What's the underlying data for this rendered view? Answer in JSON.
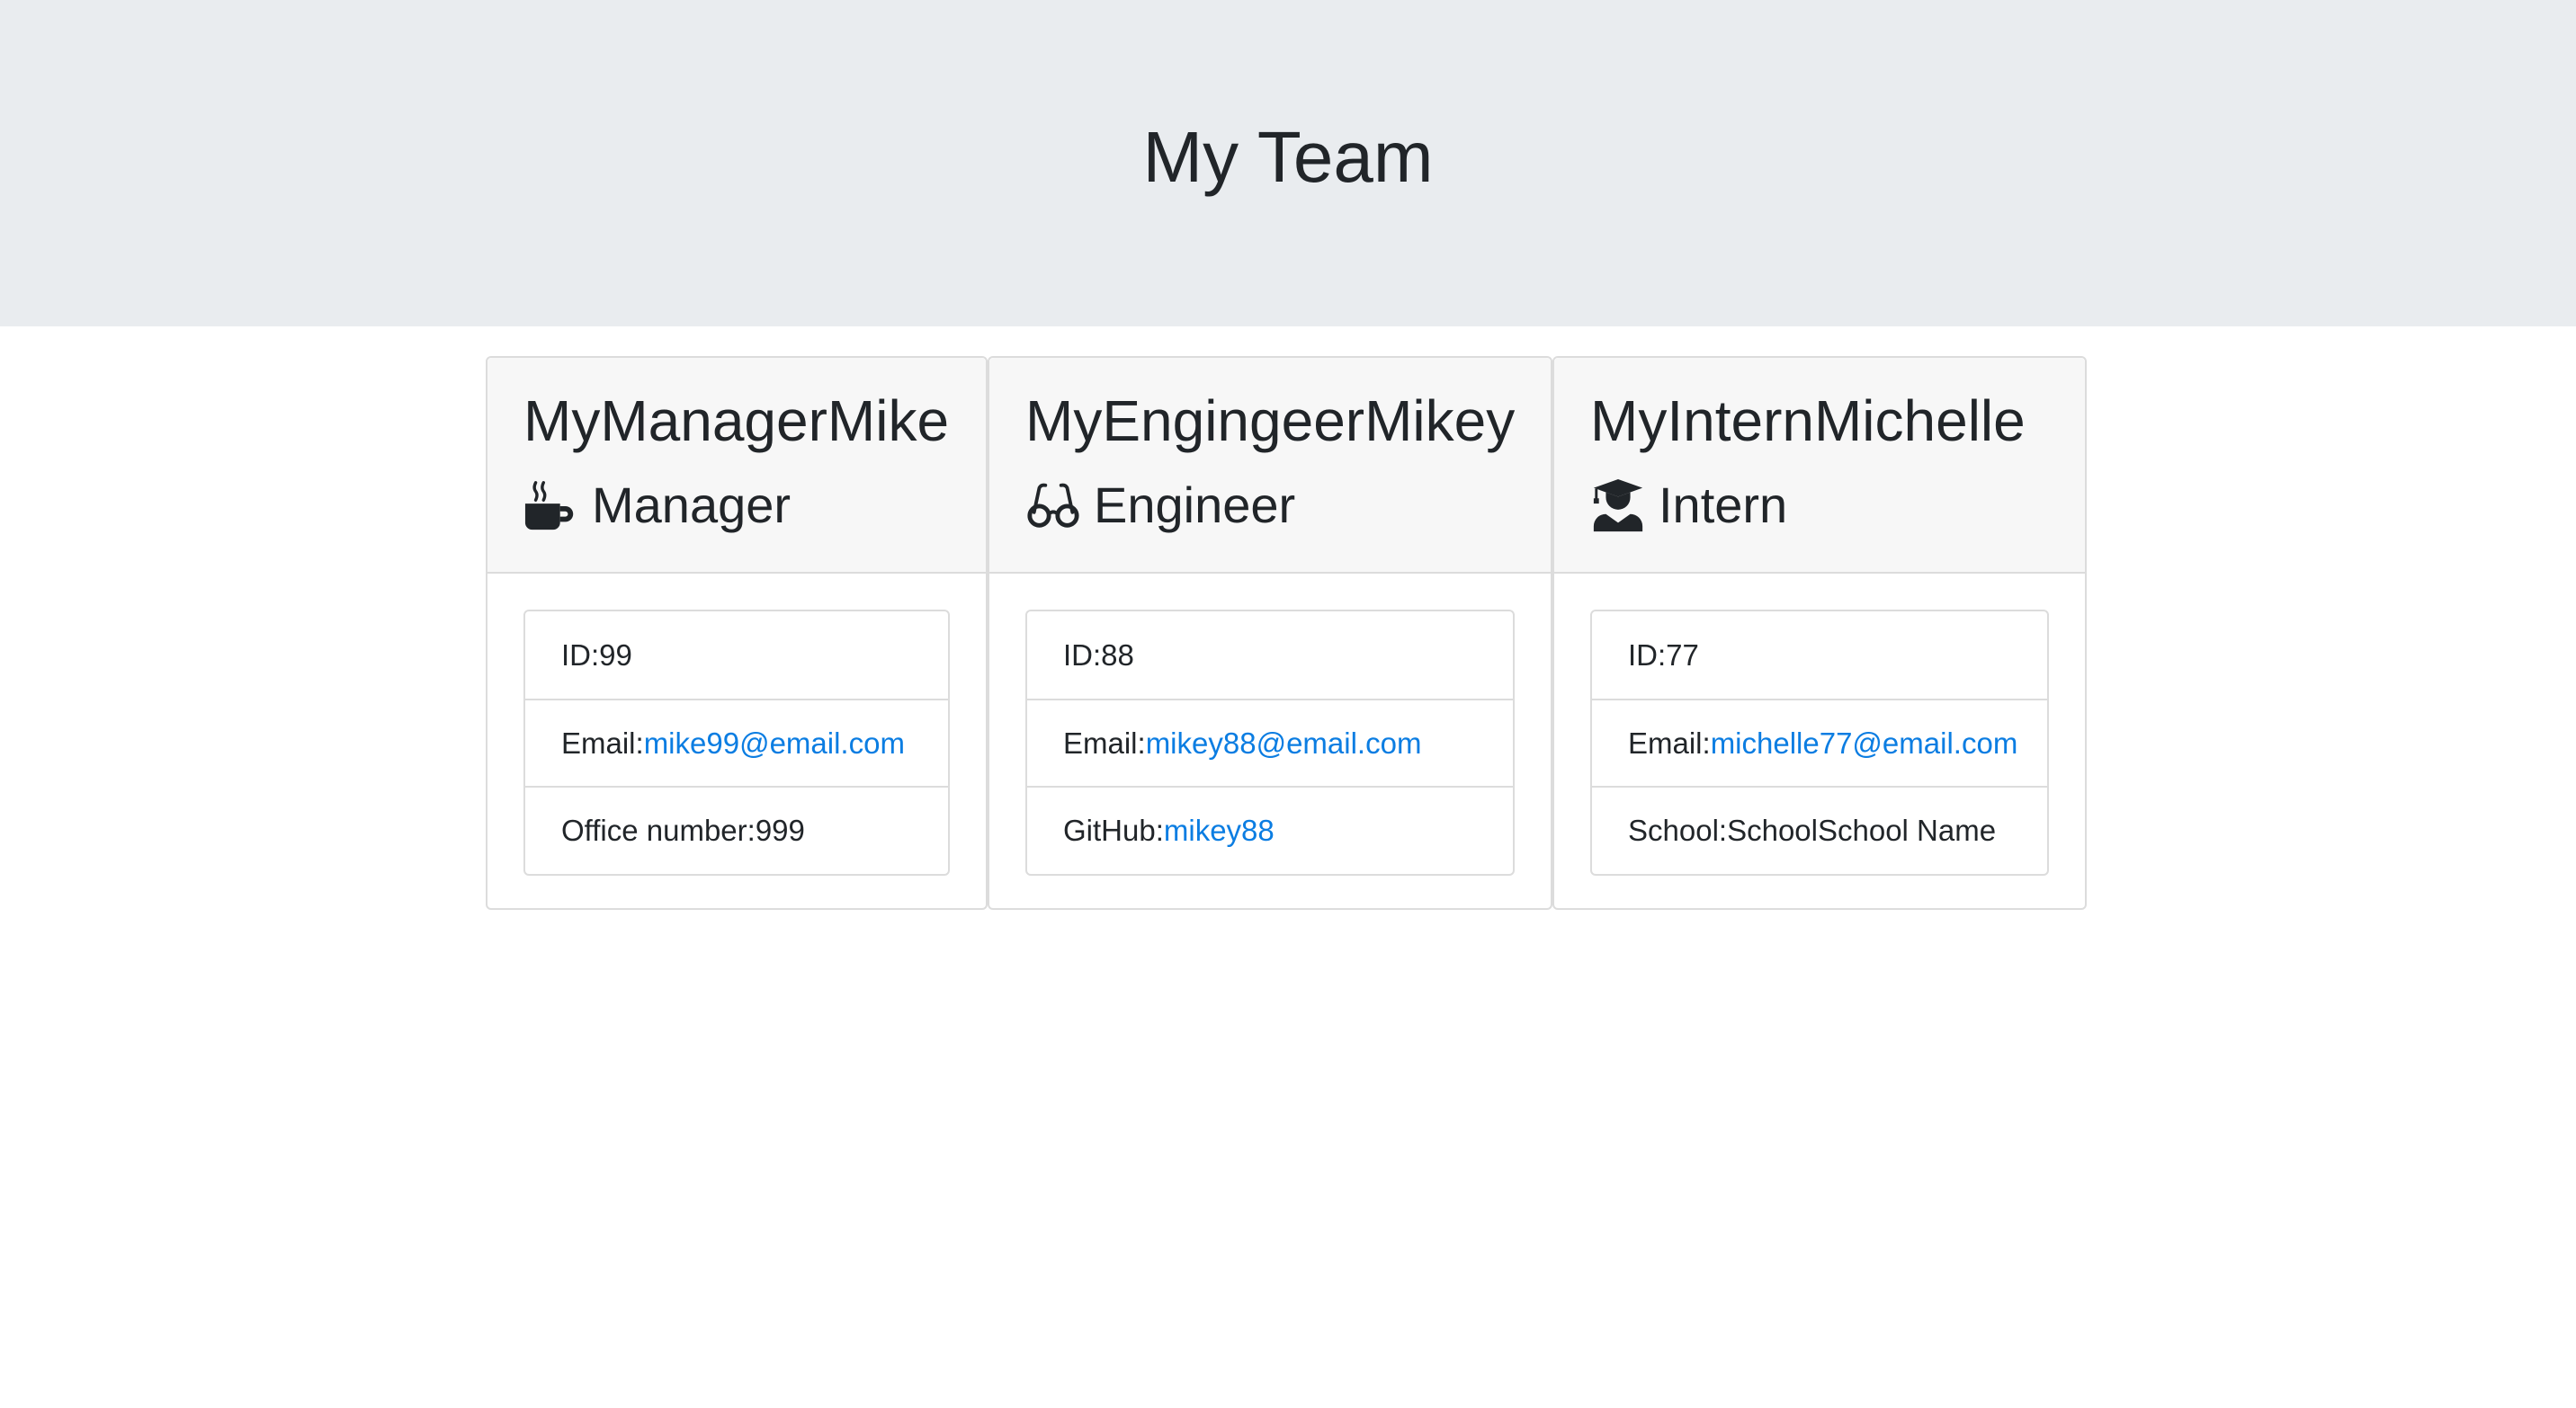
{
  "header": {
    "title": "My Team"
  },
  "cards": [
    {
      "name": "MyManagerMike",
      "role": "Manager",
      "icon": "coffee-mug-icon",
      "id_label": "ID: ",
      "id_value": "99",
      "email_label": "Email: ",
      "email_value": "mike99@email.com",
      "extra_label": "Office number: ",
      "extra_value": "999"
    },
    {
      "name": "MyEngingeerMikey",
      "role": "Engineer",
      "icon": "glasses-icon",
      "id_label": "ID: ",
      "id_value": "88",
      "email_label": "Email: ",
      "email_value": "mikey88@email.com",
      "extra_label": "GitHub: ",
      "extra_value": "mikey88"
    },
    {
      "name": "MyInternMichelle",
      "role": "Intern",
      "icon": "graduate-icon",
      "id_label": "ID: ",
      "id_value": "77",
      "email_label": "Email: ",
      "email_value": "michelle77@email.com",
      "extra_label": "School: ",
      "extra_value": "SchoolSchool Name"
    }
  ],
  "colors": {
    "link": "#0b7de2",
    "jumbotron": "#e9ecef",
    "text": "#212529"
  }
}
